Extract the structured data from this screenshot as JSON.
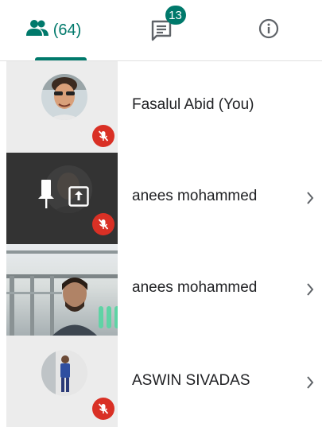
{
  "tabs": {
    "people": {
      "count_label": "(64)",
      "icon": "people-icon"
    },
    "chat": {
      "badge": "13",
      "icon": "chat-icon"
    },
    "info": {
      "icon": "info-icon"
    }
  },
  "participants": [
    {
      "name": "Fasalul Abid (You)",
      "muted": true,
      "has_chevron": false
    },
    {
      "name": "anees mohammed",
      "muted": true,
      "has_chevron": true,
      "presenting": true,
      "pinned": true
    },
    {
      "name": "anees mohammed",
      "muted": false,
      "speaking": true,
      "has_chevron": true
    },
    {
      "name": "ASWIN SIVADAS",
      "muted": true,
      "has_chevron": true
    }
  ],
  "colors": {
    "accent": "#00796b",
    "muted": "#d93025",
    "speaking": "#5fd3a5"
  }
}
